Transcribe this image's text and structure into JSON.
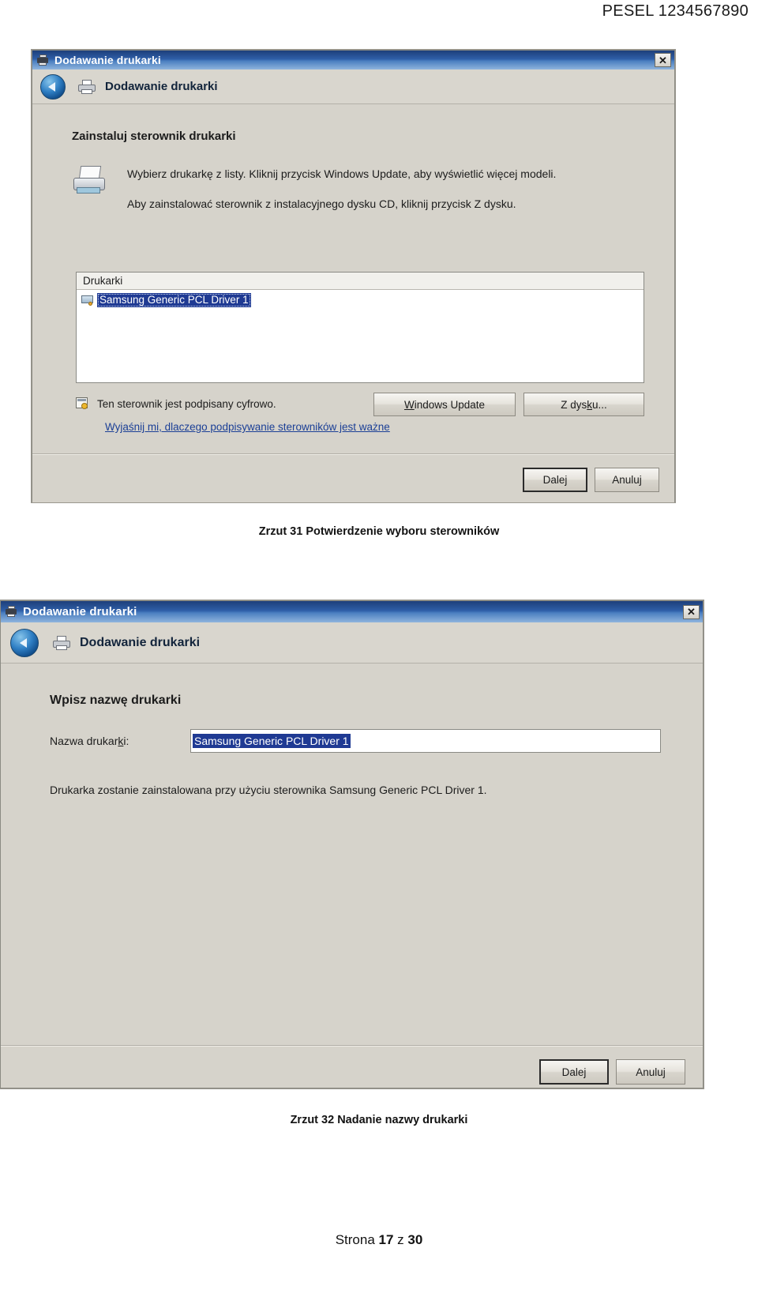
{
  "document": {
    "header": "PESEL  1234567890",
    "footer": {
      "prefix": "Strona ",
      "page": "17",
      "middle": " z ",
      "total": "30"
    }
  },
  "dialog1": {
    "titlebar": {
      "title": "Dodawanie drukarki",
      "close_label": "✕",
      "icon": "printer-icon"
    },
    "nav": {
      "title": "Dodawanie drukarki",
      "back_icon": "back-arrow-icon",
      "printer_icon": "printer-icon"
    },
    "heading": "Zainstaluj sterownik drukarki",
    "text_line1": "Wybierz drukarkę z listy. Kliknij przycisk Windows Update, aby wyświetlić więcej modeli.",
    "text_line2": "Aby zainstalować sterownik z instalacyjnego dysku CD, kliknij przycisk Z dysku.",
    "list": {
      "header": "Drukarki",
      "items": [
        {
          "label": "Samsung Generic PCL Driver 1",
          "selected": true,
          "icon": "printer-driver-icon"
        }
      ]
    },
    "signed": {
      "icon": "certificate-icon",
      "text": "Ten sterownik jest podpisany cyfrowo."
    },
    "link": "Wyjaśnij mi, dlaczego podpisywanie sterowników jest ważne",
    "buttons": {
      "windows_update_pre": "W",
      "windows_update_post": "indows Update",
      "from_disk_pre": "Z dys",
      "from_disk_key": "k",
      "from_disk_post": "u...",
      "next_pre": "Dale",
      "next_key": "j",
      "next_post": "",
      "cancel": "Anuluj"
    }
  },
  "caption1": "Zrzut 31 Potwierdzenie wyboru sterowników",
  "dialog2": {
    "titlebar": {
      "title": "Dodawanie drukarki",
      "close_label": "✕",
      "icon": "printer-icon"
    },
    "nav": {
      "title": "Dodawanie drukarki",
      "back_icon": "back-arrow-icon",
      "printer_icon": "printer-icon"
    },
    "heading": "Wpisz nazwę drukarki",
    "field_label_pre": "Nazwa drukar",
    "field_label_key": "k",
    "field_label_post": "i:",
    "field_value": "Samsung Generic PCL Driver 1",
    "description": "Drukarka zostanie zainstalowana przy użyciu sterownika Samsung Generic PCL Driver 1.",
    "buttons": {
      "next_pre": "Dale",
      "next_key": "j",
      "next_post": "",
      "cancel": "Anuluj"
    }
  },
  "caption2": "Zrzut 32 Nadanie nazwy drukarki"
}
